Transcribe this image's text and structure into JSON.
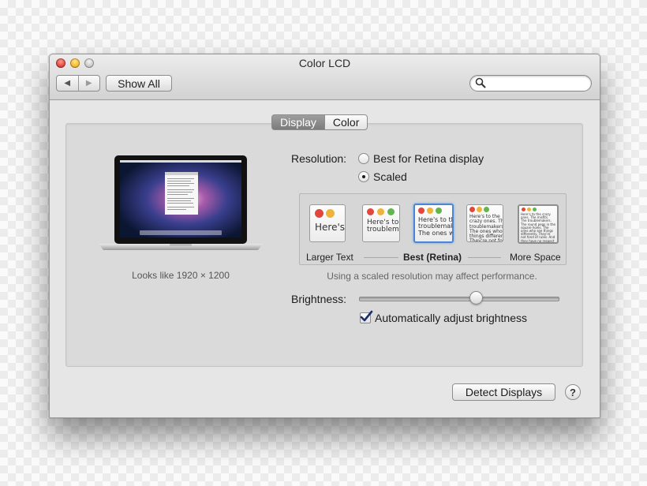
{
  "window": {
    "title": "Color LCD",
    "back_glyph": "◀",
    "forward_glyph": "▶",
    "show_all_label": "Show All",
    "search": {
      "placeholder": "",
      "value": ""
    }
  },
  "tabs": [
    {
      "label": "Display",
      "active": true
    },
    {
      "label": "Color",
      "active": false
    }
  ],
  "display_preview": {
    "caption": "Looks like 1920 × 1200"
  },
  "resolution": {
    "label": "Resolution:",
    "options": [
      {
        "label": "Best for Retina display",
        "selected": false
      },
      {
        "label": "Scaled",
        "selected": true
      }
    ]
  },
  "scaled_options": [
    {
      "sample_text": "Here's",
      "selected": false
    },
    {
      "sample_text": "Here's to the troublemakers.",
      "selected": false
    },
    {
      "sample_text": "Here's to the troublemakers. The ones who",
      "selected": true
    },
    {
      "sample_text": "Here's to the crazy ones. The troublemakers. The ones who see things differently. They're not fond of rules. And they",
      "selected": false
    },
    {
      "sample_text": "Here's to the crazy ones. The misfits. The troublemakers. The round pegs in the square holes. The ones who see things differently. They're not fond of rules. And they have no respect for the status quo. You can quote them. Disagree with them. Glorify or vilify them. About the only thing you can't do is ignore them. Because they change things.",
      "selected": false
    }
  ],
  "scale_labels": {
    "left": "Larger Text",
    "middle": "Best (Retina)",
    "right": "More Space"
  },
  "performance_hint": "Using a scaled resolution may affect performance.",
  "brightness": {
    "label": "Brightness:",
    "level": 0.59,
    "auto_label": "Automatically adjust brightness",
    "auto_checked": true
  },
  "footer": {
    "detect_label": "Detect Displays",
    "help_glyph": "?"
  },
  "colors": {
    "accent": "#4a86d6",
    "close": "#e0443a",
    "minimize": "#f5b72d"
  }
}
